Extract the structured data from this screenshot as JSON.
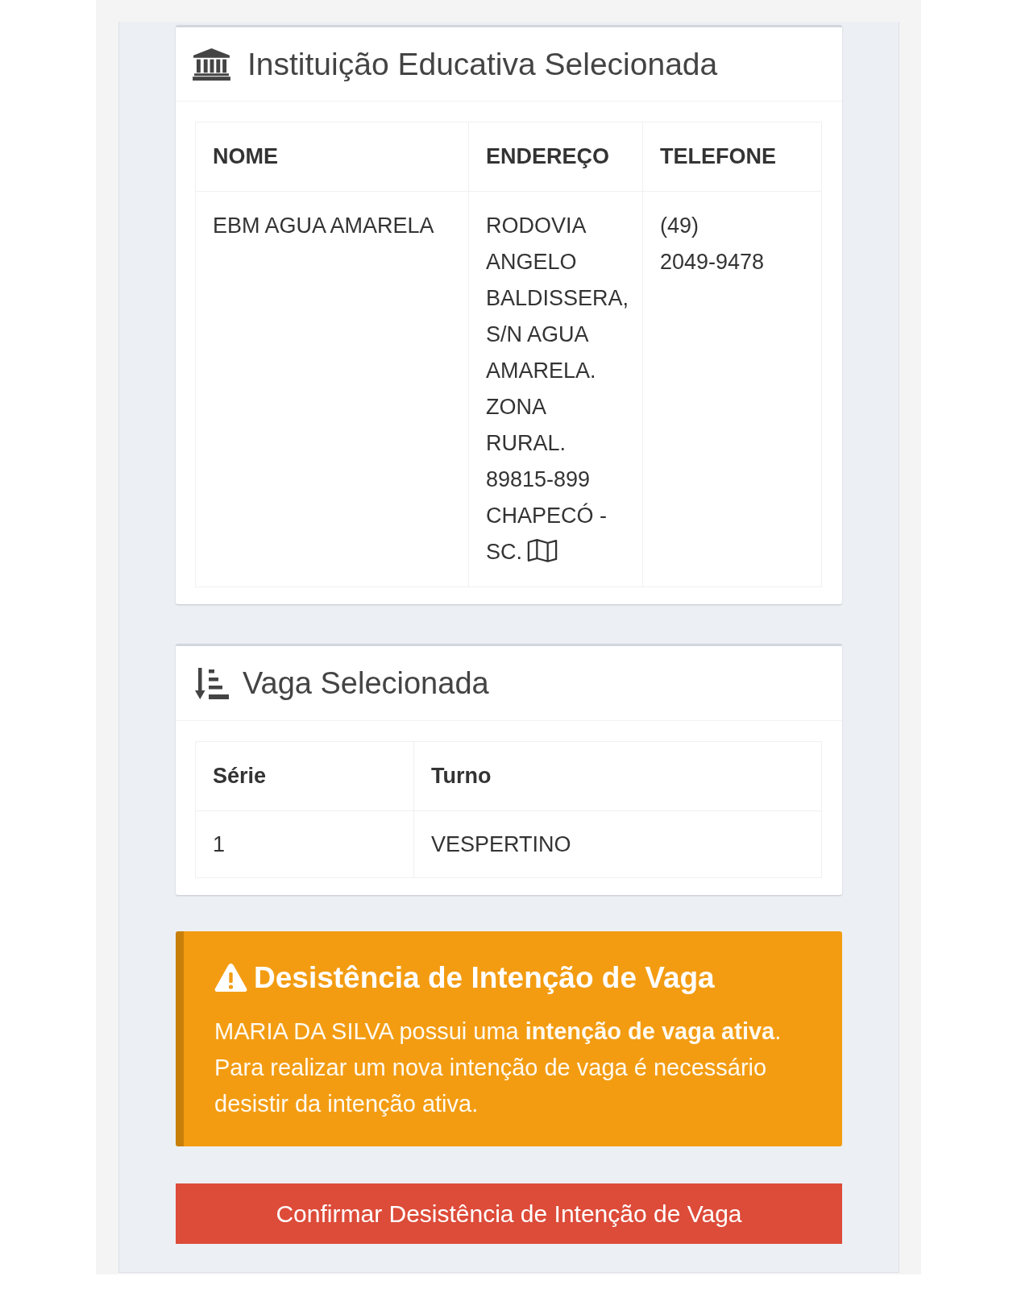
{
  "institution_card": {
    "title": "Instituição Educativa Selecionada",
    "table": {
      "columns": [
        "NOME",
        "ENDEREÇO",
        "TELEFONE"
      ],
      "rows": [
        [
          {
            "kind": "text",
            "text": "EBM AGUA AMARELA"
          },
          {
            "kind": "address",
            "lines": [
              "RODOVIA",
              "ANGELO",
              "BALDISSERA,",
              "S/N AGUA",
              "AMARELA.",
              "ZONA",
              "RURAL.",
              "89815-899",
              "CHAPECÓ -",
              "SC."
            ]
          },
          {
            "kind": "text",
            "text": "(49) 2049-9478"
          }
        ]
      ]
    }
  },
  "vacancy_card": {
    "title": "Vaga Selecionada",
    "table": {
      "columns": [
        "Série",
        "Turno"
      ],
      "rows": [
        [
          {
            "kind": "text",
            "text": "1"
          },
          {
            "kind": "text",
            "text": "VESPERTINO"
          }
        ]
      ]
    }
  },
  "alert": {
    "title": "Desistência de Intenção de Vaga",
    "message": "MARIA DA SILVA possui uma **intenção de vaga ativa**. Para realizar um nova intenção de vaga é necessário desistir da intenção ativa."
  },
  "confirm_button": "Confirmar Desistência de Intenção de Vaga"
}
